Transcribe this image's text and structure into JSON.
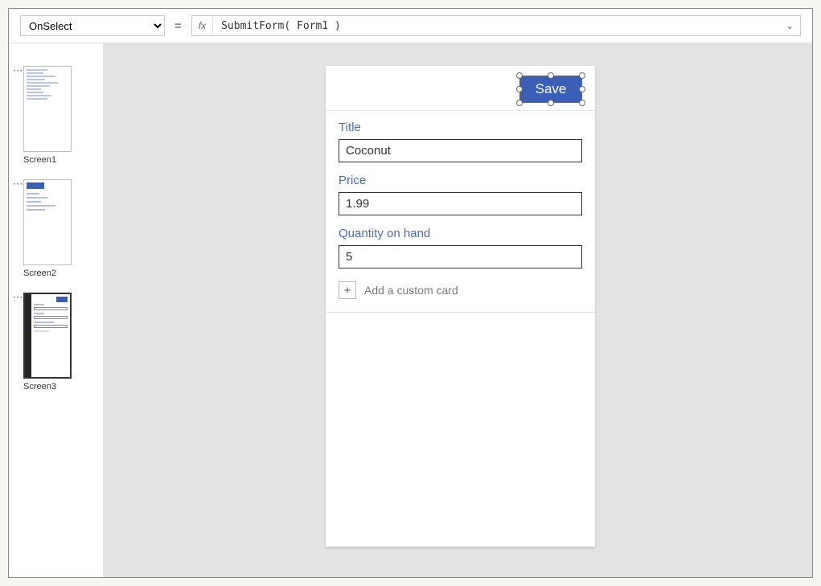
{
  "formulaBar": {
    "property": "OnSelect",
    "equals": "=",
    "fxLabel": "fx",
    "expression": "SubmitForm( Form1 )"
  },
  "thumbnails": {
    "screen1": "Screen1",
    "screen2": "Screen2",
    "screen3": "Screen3"
  },
  "form": {
    "saveLabel": "Save",
    "fields": {
      "title": {
        "label": "Title",
        "value": "Coconut"
      },
      "price": {
        "label": "Price",
        "value": "1.99"
      },
      "qty": {
        "label": "Quantity on hand",
        "value": "5"
      }
    },
    "addCard": "Add a custom card"
  }
}
